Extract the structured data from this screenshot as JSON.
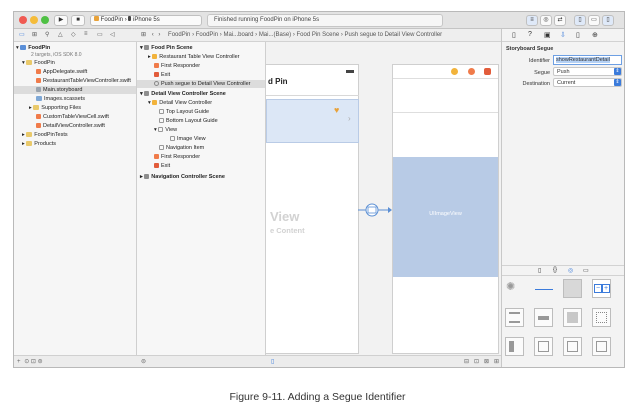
{
  "toolbar": {
    "scheme": "FoodPin",
    "device": "iPhone 5s",
    "status": "Finished running FoodPin on iPhone 5s"
  },
  "jump_bar": [
    "FoodPin",
    "FoodPin",
    "Mai...board",
    "Mai...(Base)",
    "Food Pin Scene",
    "Push segue to Detail View Controller"
  ],
  "navigator": {
    "project": "FoodPin",
    "project_sub": "2 targets, iOS SDK 8.0",
    "items": [
      {
        "label": "FoodPin"
      },
      {
        "label": "AppDelegate.swift"
      },
      {
        "label": "RestaurantTableViewController.swift"
      },
      {
        "label": "Main.storyboard"
      },
      {
        "label": "Images.xcassets"
      },
      {
        "label": "Supporting Files"
      },
      {
        "label": "CustomTableViewCell.swift"
      },
      {
        "label": "DetailViewController.swift"
      },
      {
        "label": "FoodPinTests"
      },
      {
        "label": "Products"
      }
    ]
  },
  "outline": {
    "scene1": "Food Pin Scene",
    "rtvc": "Restaurant Table View Controller",
    "first_responder": "First Responder",
    "exit": "Exit",
    "segue": "Push segue to Detail View Controller",
    "scene2": "Detail View Controller Scene",
    "dvc": "Detail View Controller",
    "top_guide": "Top Layout Guide",
    "bottom_guide": "Bottom Layout Guide",
    "view": "View",
    "image_view": "Image View",
    "nav_item": "Navigation Item",
    "first_responder2": "First Responder",
    "exit2": "Exit",
    "scene3": "Navigation Controller Scene"
  },
  "canvas": {
    "left_title": "d Pin",
    "left_view": "View",
    "left_content": "e Content",
    "image_label": "UIImageView"
  },
  "inspector": {
    "section": "Storyboard Segue",
    "identifier_label": "Identifier",
    "identifier_value": "showRestaurantDetail",
    "segue_label": "Segue",
    "segue_value": "Push",
    "destination_label": "Destination",
    "destination_value": "Current"
  },
  "caption": "Figure 9-11. Adding a Segue Identifier",
  "colors": {
    "accent": "#3b7bdb",
    "selection": "#dcdcdc",
    "image_view_fill": "#b8cbe6",
    "segue_blue": "#5b8fd4"
  }
}
